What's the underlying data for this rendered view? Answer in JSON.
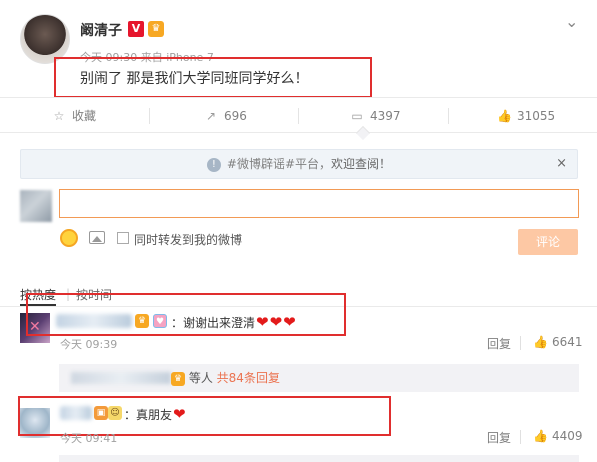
{
  "post": {
    "author": "阚清子",
    "vip_badge": "V",
    "time": "今天 09:30",
    "source": "来自 iPhone 7",
    "text": "别闹了 那是我们大学同班同学好么！"
  },
  "actions": {
    "favorite_label": "收藏",
    "forward_count": "696",
    "comment_count": "4397",
    "like_count": "31055"
  },
  "notice": {
    "tag": "#微博辟谣#平台，",
    "message": "欢迎查阅！",
    "close": "×"
  },
  "comment_box": {
    "repost_label": "同时转发到我的微博",
    "submit_label": "评论"
  },
  "sort": {
    "hot": "按热度",
    "time": "按时间"
  },
  "comments": [
    {
      "text": "：谢谢出来澄清",
      "time": "今天 09:39",
      "reply": "回复",
      "likes": "6641",
      "subreplies": {
        "names_suffix": "等人",
        "count_link": "共84条回复"
      }
    },
    {
      "text": "：真朋友",
      "time": "今天 09:41",
      "reply": "回复",
      "likes": "4409"
    }
  ],
  "colors": {
    "highlight_box": "#e02e2e",
    "input_border": "#f29a55",
    "submit_bg": "#fdc8a4",
    "link": "#eb7350"
  }
}
